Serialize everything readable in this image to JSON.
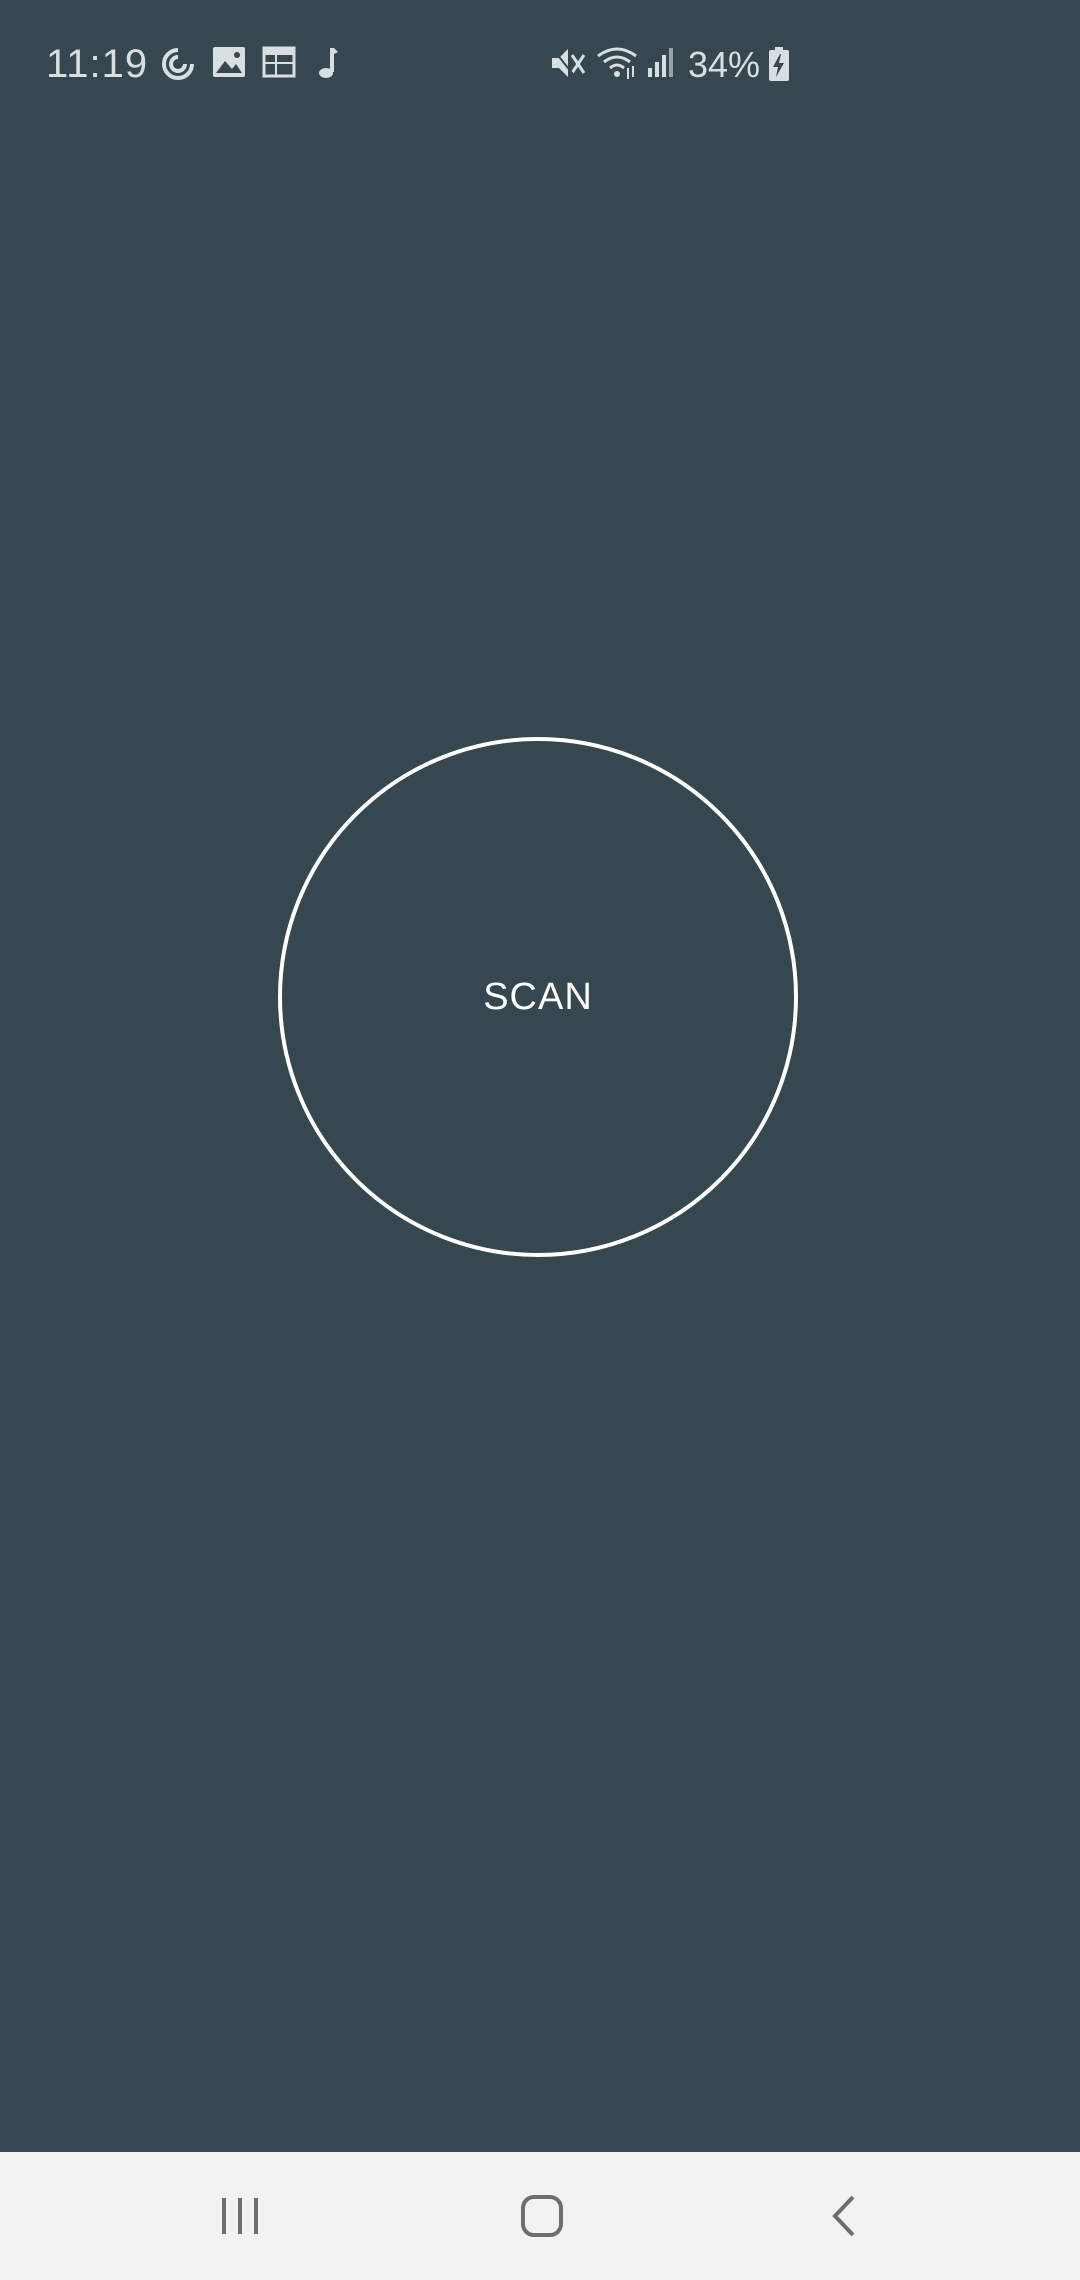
{
  "status_bar": {
    "time": "11:19",
    "battery_percent": "34%",
    "notification_icons": [
      "sync-icon",
      "image-icon",
      "calendar-icon",
      "music-note-icon"
    ],
    "system_icons": [
      "mute-icon",
      "wifi-icon",
      "cellular-signal-icon",
      "battery-charging-icon"
    ]
  },
  "main": {
    "scan_label": "SCAN"
  },
  "nav_bar": {
    "buttons": [
      "recent-apps-icon",
      "home-icon",
      "back-icon"
    ]
  },
  "colors": {
    "background": "#37474f",
    "accent": "#ffffff",
    "nav_background": "#f2f2f2"
  }
}
